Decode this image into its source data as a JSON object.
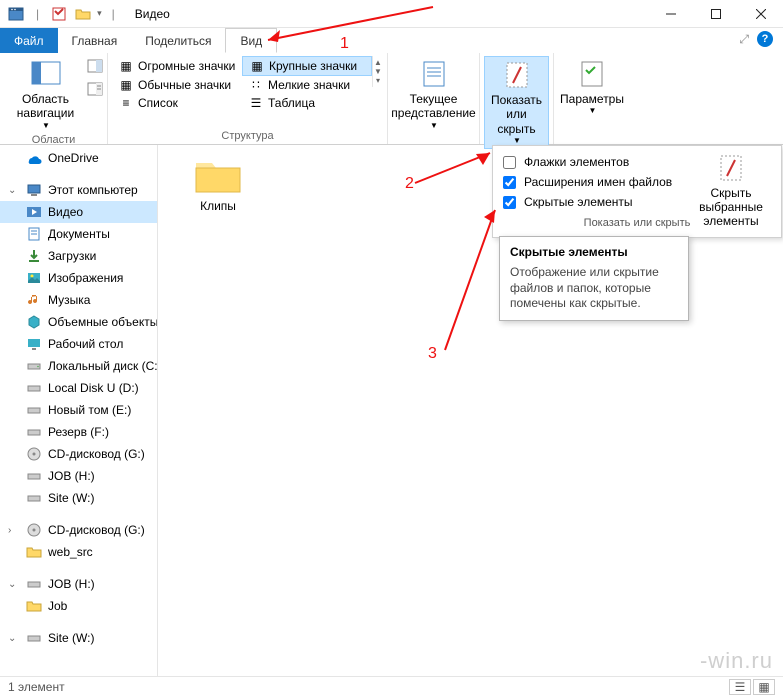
{
  "titlebar": {
    "title": "Видео",
    "sep": "|"
  },
  "tabs": {
    "file": "Файл",
    "home": "Главная",
    "share": "Поделиться",
    "view": "Вид"
  },
  "ribbon": {
    "panes": {
      "nav": "Область навигации",
      "group": "Области"
    },
    "layout": {
      "huge": "Огромные значки",
      "large": "Крупные значки",
      "normal": "Обычные значки",
      "small": "Мелкие значки",
      "list": "Список",
      "table": "Таблица",
      "group": "Структура"
    },
    "currentview": {
      "btn": "Текущее представление"
    },
    "showhide": {
      "btn": "Показать или скрыть"
    },
    "options": {
      "btn": "Параметры"
    }
  },
  "showhide_panel": {
    "checkboxes": {
      "flags": "Флажки элементов",
      "ext": "Расширения имен файлов",
      "hidden": "Скрытые элементы"
    },
    "hide_selected": "Скрыть выбранные элементы",
    "footer": "Показать или скрыть"
  },
  "tooltip": {
    "title": "Скрытые элементы",
    "body": "Отображение или скрытие файлов и папок, которые помечены как скрытые."
  },
  "tree": {
    "onedrive": "OneDrive",
    "thispc": "Этот компьютер",
    "video": "Видео",
    "documents": "Документы",
    "downloads": "Загрузки",
    "pictures": "Изображения",
    "music": "Музыка",
    "objects3d": "Объемные объекты",
    "desktop": "Рабочий стол",
    "localdisk": "Локальный диск (C:)",
    "localdisku": "Local Disk U (D:)",
    "newvol": "Новый том (E:)",
    "reserve": "Резерв (F:)",
    "cddrive1": "CD-дисковод (G:)",
    "jobh": "JOB (H:)",
    "sitew": "Site (W:)",
    "cddrive2": "CD-дисковод (G:)",
    "websrc": "web_src",
    "jobh2": "JOB (H:)",
    "job": "Job",
    "sitew2": "Site (W:)"
  },
  "files": {
    "clips": "Клипы"
  },
  "status": {
    "count": "1 элемент"
  },
  "annotations": {
    "n1": "1",
    "n2": "2",
    "n3": "3"
  },
  "watermark": "-win.ru"
}
